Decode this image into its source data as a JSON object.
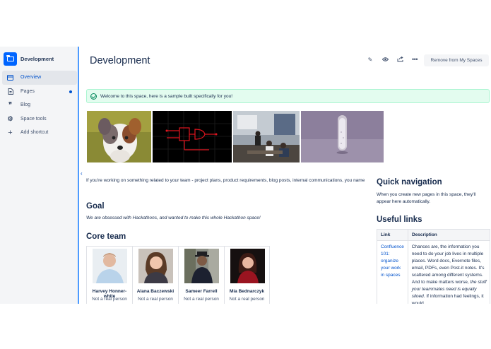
{
  "sidebar": {
    "space_name": "Development",
    "items": [
      {
        "label": "Overview",
        "icon": "overview-icon"
      },
      {
        "label": "Pages",
        "icon": "pages-icon"
      },
      {
        "label": "Blog",
        "icon": "blog-quote-icon"
      },
      {
        "label": "Space tools",
        "icon": "gear-icon"
      },
      {
        "label": "Add shortcut",
        "icon": "plus-icon"
      }
    ]
  },
  "header": {
    "title": "Development",
    "remove_button": "Remove from My Spaces",
    "icons": [
      "edit-pencil-icon",
      "watch-eye-icon",
      "share-icon",
      "more-icon"
    ]
  },
  "info_panel": {
    "text": "Welcome to this space, here is a sample built specifically for you!"
  },
  "content": {
    "intro": "If you're working on something related to your team - project plans, product requirements, blog posts, internal communications, you name",
    "goal_heading": "Goal",
    "goal_text": "We are obsessed with Hackathons, and wanted to make this whole Hackathon space!",
    "team_heading": "Core team",
    "team": [
      {
        "name": "Harvey Honner-white",
        "role": "Not a real person"
      },
      {
        "name": "Alana Baczewski",
        "role": "Not a real person"
      },
      {
        "name": "Sameer Farrell",
        "role": "Not a real person"
      },
      {
        "name": "Mia Bednarczyk",
        "role": "Not a real person"
      }
    ]
  },
  "quick_nav": {
    "heading": "Quick navigation",
    "text": "When you create new pages in this space, they'll appear here automatically."
  },
  "useful_links": {
    "heading": "Useful links",
    "col_link": "Link",
    "col_description": "Description",
    "row_link": "Confluence 101: organize your work in spaces",
    "row_desc_1": "Chances are, the information you need to do your job lives in multiple places. Word docs, Evernote files, email, PDFs, even Post-it notes. It's scattered among different systems. And to make matters worse, ",
    "row_desc_em": "the stuff your teammates need is equally siloed.",
    "row_desc_2": " If information had feelings, it would"
  },
  "colors": {
    "accent": "#0052cc",
    "brand": "#0065ff",
    "success_bg": "#e3fcef",
    "success": "#00875a"
  }
}
